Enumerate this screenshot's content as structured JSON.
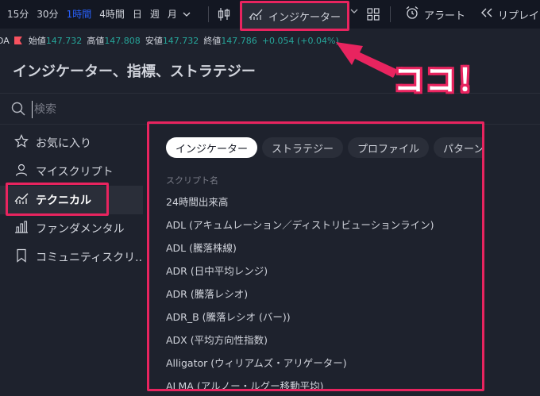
{
  "toolbar": {
    "timeframes": [
      "15分",
      "30分",
      "1時間",
      "4時間",
      "日",
      "週",
      "月"
    ],
    "active_timeframe": "1時間",
    "indicators_label": "インジケーター",
    "alert_label": "アラート",
    "replay_label": "リプレイ"
  },
  "ohlc": {
    "symbol": "DA",
    "open_label": "始値",
    "open": "147.732",
    "high_label": "高値",
    "high": "147.808",
    "low_label": "安値",
    "low": "147.732",
    "close_label": "終値",
    "close": "147.786",
    "change": "+0.054 (+0.04%)"
  },
  "dialog": {
    "title": "インジケーター、指標、ストラテジー",
    "search_placeholder": "検索"
  },
  "callout": "ココ！",
  "sidebar": {
    "items": [
      {
        "label": "お気に入り"
      },
      {
        "label": "マイスクリプト"
      },
      {
        "label": "テクニカル"
      },
      {
        "label": "ファンダメンタル"
      },
      {
        "label": "コミュニティスクリ..."
      }
    ]
  },
  "content": {
    "tabs": [
      "インジケーター",
      "ストラテジー",
      "プロファイル",
      "パターン"
    ],
    "column_header": "スクリプト名",
    "rows": [
      "24時間出来高",
      "ADL (アキュムレーション／ディストリビューションライン)",
      "ADL (騰落株線)",
      "ADR (日中平均レンジ)",
      "ADR (騰落レシオ)",
      "ADR_B (騰落レシオ (バー))",
      "ADX (平均方向性指数)",
      "Alligator (ウィリアムズ・アリゲーター)",
      "ALMA (アルノー・ルグー移動平均)"
    ]
  },
  "colors": {
    "accent": "#e8245f",
    "active_timeframe": "#2962ff",
    "positive": "#26a69a",
    "background": "#1e222d"
  }
}
